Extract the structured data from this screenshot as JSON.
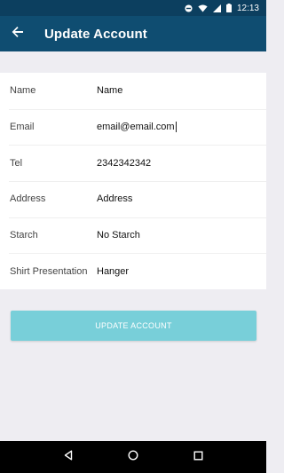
{
  "status_bar": {
    "time": "12:13",
    "icons": [
      "dnd-icon",
      "wifi-icon",
      "signal-icon",
      "battery-icon"
    ]
  },
  "app_bar": {
    "title": "Update Account",
    "back_icon": "arrow-left-icon",
    "color": "#0f4d71"
  },
  "form": {
    "fields": [
      {
        "label": "Name",
        "value": "Name"
      },
      {
        "label": "Email",
        "value": "email@email.com"
      },
      {
        "label": "Tel",
        "value": "2342342342"
      },
      {
        "label": "Address",
        "value": "Address"
      },
      {
        "label": "Starch",
        "value": "No Starch"
      },
      {
        "label": "Shirt Presentation",
        "value": "Hanger"
      }
    ]
  },
  "update_button": {
    "label": "UPDATE ACCOUNT",
    "color": "#78cfd9"
  },
  "nav_bar": {
    "icons": [
      "back-triangle-icon",
      "home-circle-icon",
      "recents-square-icon"
    ]
  }
}
